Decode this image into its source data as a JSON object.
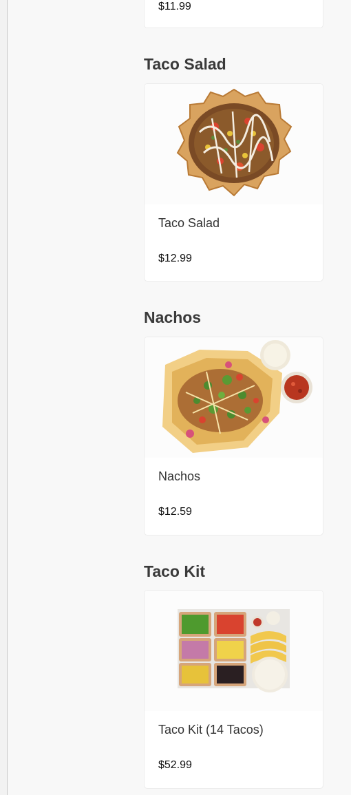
{
  "previous_item": {
    "price": "$11.99"
  },
  "sections": [
    {
      "title": "Taco Salad",
      "item": {
        "name": "Taco Salad",
        "price": "$12.99",
        "image_icon": "taco-salad-image"
      }
    },
    {
      "title": "Nachos",
      "item": {
        "name": "Nachos",
        "price": "$12.59",
        "image_icon": "nachos-image"
      }
    },
    {
      "title": "Taco Kit",
      "item": {
        "name": "Taco Kit (14 Tacos)",
        "price": "$52.99",
        "image_icon": "taco-kit-image"
      }
    }
  ],
  "colors": {
    "background": "#f8f8f8",
    "card": "#ffffff",
    "heading": "#3a3a3a"
  }
}
